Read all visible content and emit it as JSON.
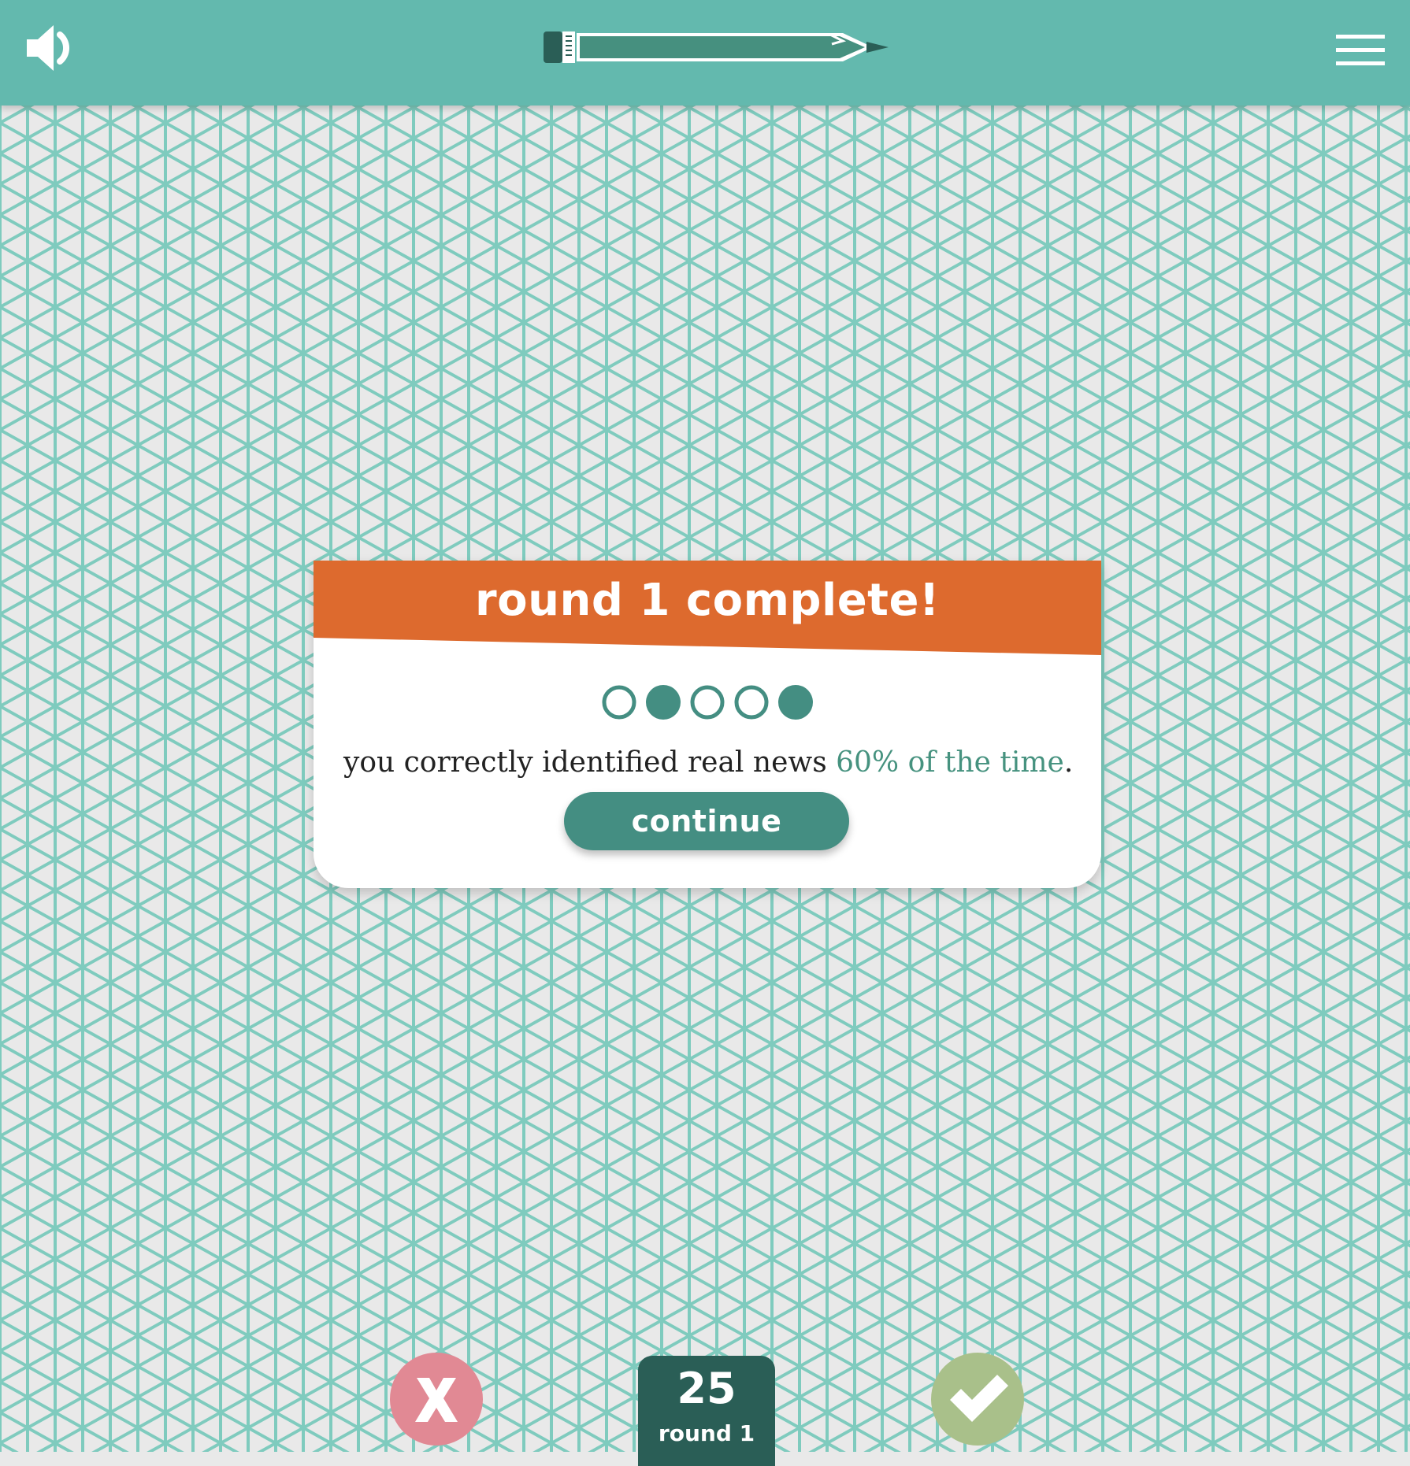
{
  "header": {
    "sound_icon": "speaker-icon",
    "menu_icon": "hamburger-menu-icon",
    "progress_icon": "pencil-icon",
    "progress_fraction": 1.0
  },
  "modal": {
    "title": "round 1 complete!",
    "answer_dots": [
      false,
      true,
      false,
      false,
      true
    ],
    "result_prefix": "you correctly identified real news ",
    "result_highlight": "60% of the time",
    "result_suffix": ".",
    "continue_label": "continue"
  },
  "footer": {
    "score": "25",
    "round_label": "round 1",
    "no_icon": "x-icon",
    "yes_icon": "checkmark-icon"
  },
  "colors": {
    "header_bg": "#63b9ae",
    "banner": "#dd6a2e",
    "accent": "#448e82",
    "grid_line": "#7fcbbe",
    "no_button": "#e18994",
    "yes_button": "#a9c08a",
    "score_bg": "#2a5e56"
  }
}
